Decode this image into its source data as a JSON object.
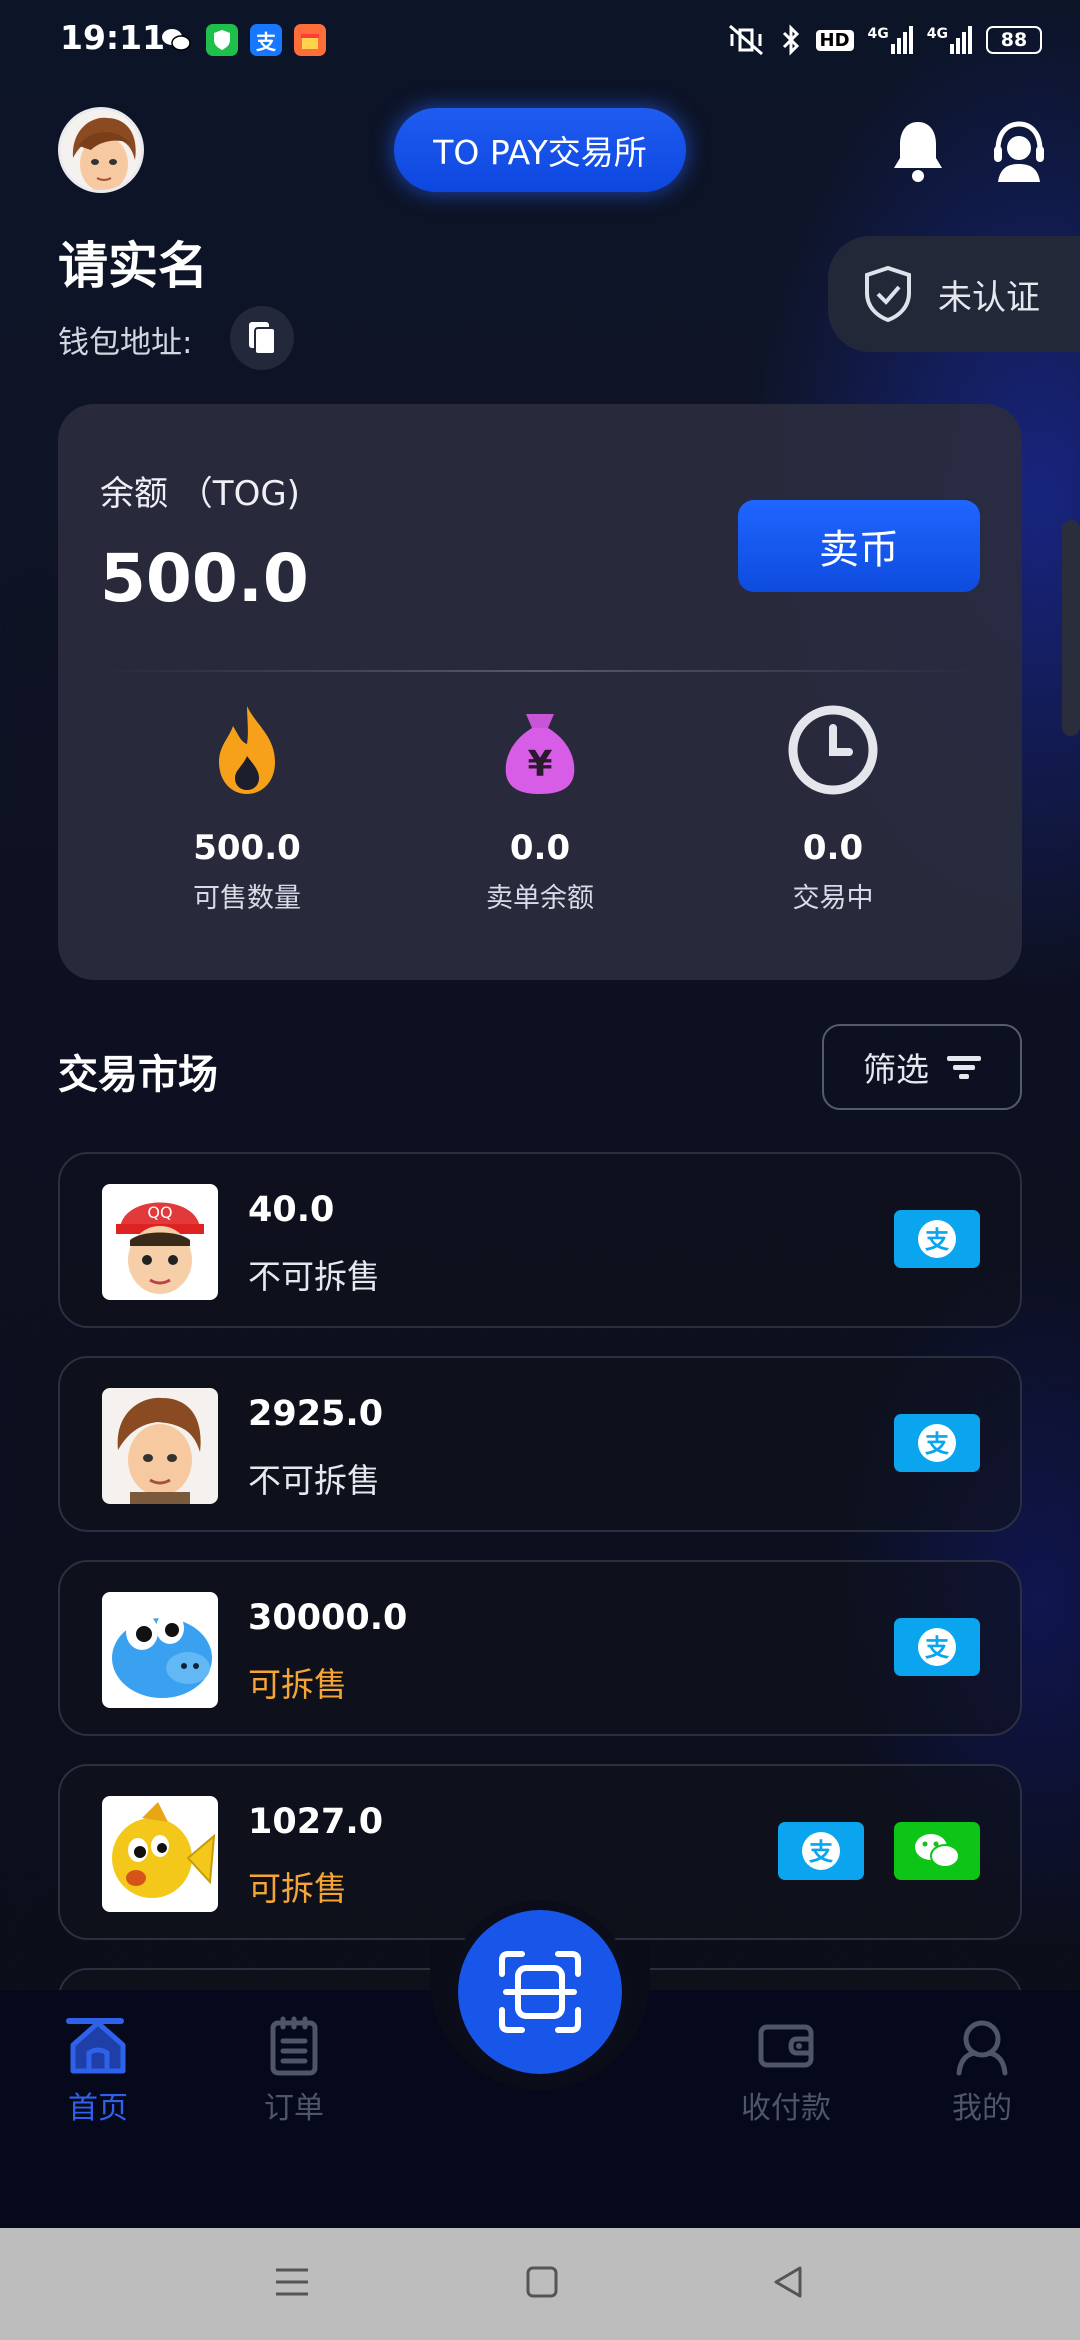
{
  "status_bar": {
    "time": "19:11",
    "network_1": "4G",
    "network_2": "4G",
    "hd_label": "HD",
    "battery": "88",
    "apps": [
      {
        "icon": "wechat-icon",
        "glyph": "",
        "color": "#ffffff"
      },
      {
        "icon": "shield-icon",
        "glyph": "",
        "color": "#1fbf4c"
      },
      {
        "icon": "alipay-icon",
        "glyph": "支",
        "color": "#1677ff"
      },
      {
        "icon": "gift-app-icon",
        "glyph": "",
        "color": "#ff6d3b"
      }
    ]
  },
  "header": {
    "title": "TO PAY交易所",
    "bell_icon": "bell-icon",
    "support_icon": "headset-icon"
  },
  "profile": {
    "name": "请实名",
    "wallet_label": "钱包地址:",
    "verify_label": "未认证"
  },
  "balance_card": {
    "label": "余额 （TOG)",
    "value": "500.0",
    "sell_label": "卖币",
    "stats": [
      {
        "icon": "fire-icon",
        "value": "500.0",
        "label": "可售数量"
      },
      {
        "icon": "money-bag-icon",
        "value": "0.0",
        "label": "卖单余额"
      },
      {
        "icon": "clock-icon",
        "value": "0.0",
        "label": "交易中"
      }
    ]
  },
  "market": {
    "title": "交易市场",
    "filter_label": "筛选",
    "items": [
      {
        "amount": "40.0",
        "status": "不可拆售",
        "status_color": "#e6e8ef",
        "payments": [
          "alipay"
        ]
      },
      {
        "amount": "2925.0",
        "status": "不可拆售",
        "status_color": "#e6e8ef",
        "payments": [
          "alipay"
        ]
      },
      {
        "amount": "30000.0",
        "status": "可拆售",
        "status_color": "#f5a536",
        "payments": [
          "alipay"
        ]
      },
      {
        "amount": "1027.0",
        "status": "可拆售",
        "status_color": "#f5a536",
        "payments": [
          "alipay",
          "wechat"
        ]
      }
    ]
  },
  "bottom_nav": {
    "items": [
      {
        "label": "首页",
        "icon": "home-icon",
        "active": true
      },
      {
        "label": "订单",
        "icon": "clipboard-icon",
        "active": false
      },
      {
        "label": "收付款",
        "icon": "wallet-icon",
        "active": false
      },
      {
        "label": "我的",
        "icon": "profile-icon",
        "active": false
      }
    ],
    "scan_icon": "scan-icon"
  },
  "colors": {
    "accent": "#1856ea",
    "alipay": "#0aa5ee",
    "wechat": "#0dc516",
    "splittable": "#f5a536"
  }
}
